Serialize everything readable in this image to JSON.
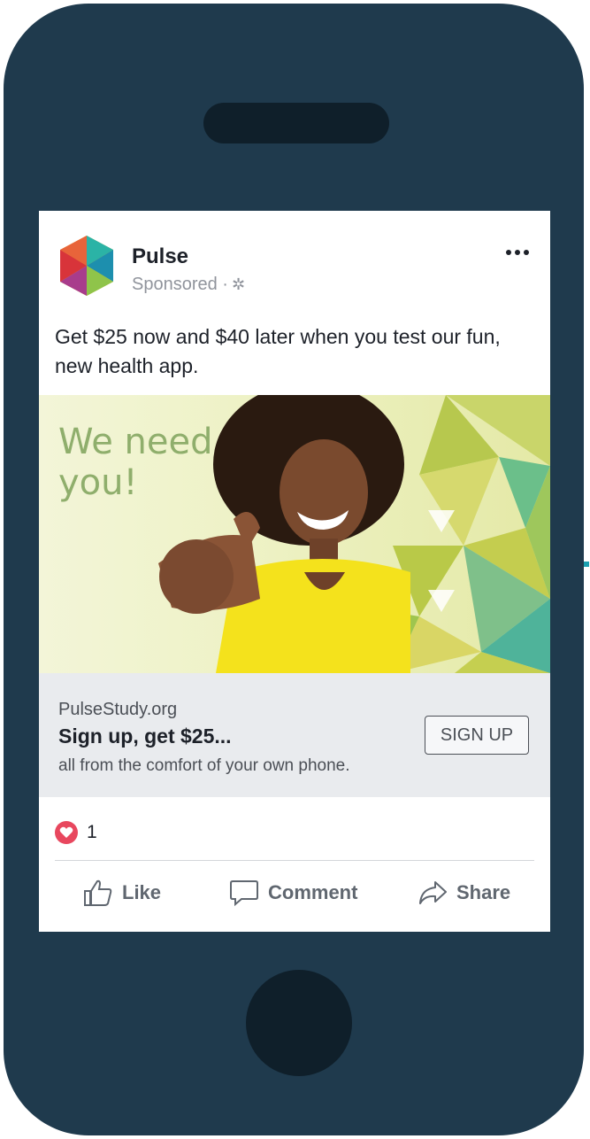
{
  "post": {
    "page_name": "Pulse",
    "sponsored": "Sponsored ·",
    "text": "Get $25 now and $40 later when you test our fun, new health app."
  },
  "ad": {
    "headline_line1": "We need",
    "headline_line2": "you!"
  },
  "link": {
    "domain": "PulseStudy.org",
    "title": "Sign up, get $25...",
    "description": "all from the comfort of your own phone.",
    "cta": "SIGN UP"
  },
  "reactions": {
    "count": "1"
  },
  "actions": {
    "like": "Like",
    "comment": "Comment",
    "share": "Share"
  },
  "colors": {
    "phone_body": "#1f3a4d",
    "reaction_heart": "#e8475e",
    "headline_green": "#8fae6c"
  }
}
